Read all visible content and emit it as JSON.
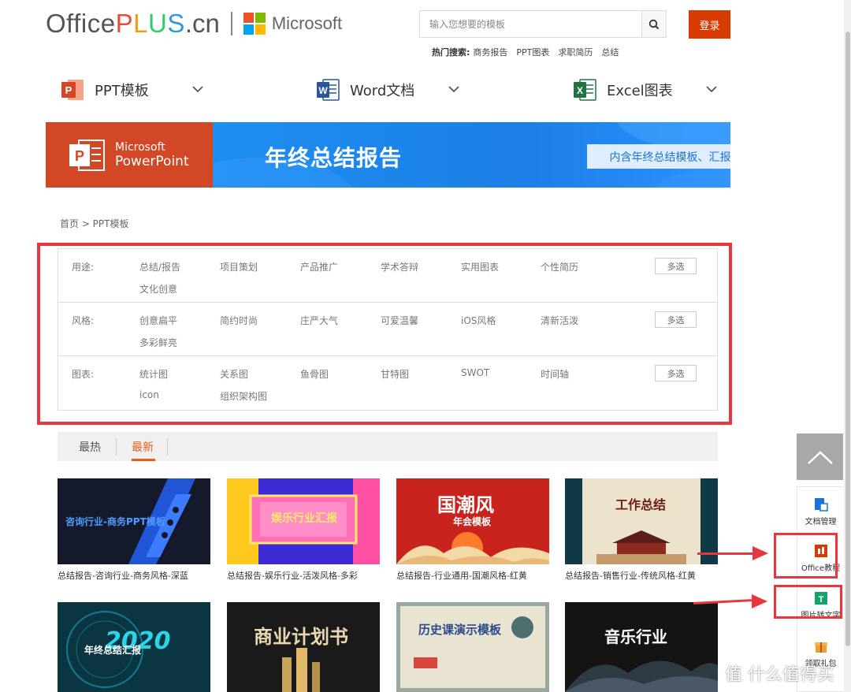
{
  "header": {
    "logo_office": "Office",
    "logo_plus": [
      "P",
      "L",
      "U",
      "S"
    ],
    "logo_cn": ".cn",
    "ms_text": "Microsoft",
    "search_placeholder": "输入您想要的模板",
    "login_label": "登录",
    "hot_label": "热门搜索:",
    "hot_terms": [
      "商务报告",
      "PPT图表",
      "求职简历",
      "总结"
    ]
  },
  "categories": [
    {
      "label": "PPT模板",
      "icon": "powerpoint-icon",
      "color": "#d24726"
    },
    {
      "label": "Word文档",
      "icon": "word-icon",
      "color": "#2b579a"
    },
    {
      "label": "Excel图表",
      "icon": "excel-icon",
      "color": "#217346"
    }
  ],
  "banner": {
    "ms_line": "Microsoft",
    "pp_line": "PowerPoint",
    "title": "年终总结报告",
    "tag": "内含年终总结模板、汇报范文和汇报小技巧"
  },
  "breadcrumb": "首页 > PPT模板",
  "filters": [
    {
      "label": "用途:",
      "items": [
        "总结/报告",
        "项目策划",
        "产品推广",
        "学术答辩",
        "实用图表",
        "个性简历",
        "文化创意"
      ],
      "multi": "多选"
    },
    {
      "label": "风格:",
      "items": [
        "创意扁平",
        "简约时尚",
        "庄严大气",
        "可爱温馨",
        "iOS风格",
        "清新活泼",
        "多彩鲜亮"
      ],
      "multi": "多选"
    },
    {
      "label": "图表:",
      "items": [
        "统计图",
        "关系图",
        "鱼骨图",
        "甘特图",
        "SWOT",
        "时间轴",
        "icon",
        "组织架构图"
      ],
      "multi": "多选"
    }
  ],
  "tabs": [
    {
      "label": "最热",
      "active": false
    },
    {
      "label": "最新",
      "active": true
    }
  ],
  "cards": [
    {
      "thumb_title": "咨询行业-商务PPT模板",
      "caption": "总结报告-咨询行业-商务风格-深蓝"
    },
    {
      "thumb_title": "娱乐行业汇报",
      "caption": "总结报告-娱乐行业-活泼风格-多彩"
    },
    {
      "thumb_title": "国潮风",
      "thumb_sub": "年会模板",
      "caption": "总结报告-行业通用-国潮风格-红黄"
    },
    {
      "thumb_title": "工作总结",
      "caption": "总结报告-销售行业-传统风格-红黄"
    },
    {
      "thumb_title": "年终总结汇报",
      "thumb_big": "2020",
      "caption": ""
    },
    {
      "thumb_title": "商业计划书",
      "caption": ""
    },
    {
      "thumb_title": "历史课演示模板",
      "caption": ""
    },
    {
      "thumb_title": "音乐行业",
      "caption": ""
    }
  ],
  "sidebar": {
    "items": [
      {
        "label": "文档管理",
        "icon": "document-manage-icon"
      },
      {
        "label": "Office教程",
        "icon": "office-tutorial-icon"
      },
      {
        "label": "图片转文字",
        "icon": "image-to-text-icon"
      },
      {
        "label": "领取礼包",
        "icon": "gift-icon"
      }
    ]
  },
  "watermark": "值 什么值得买"
}
